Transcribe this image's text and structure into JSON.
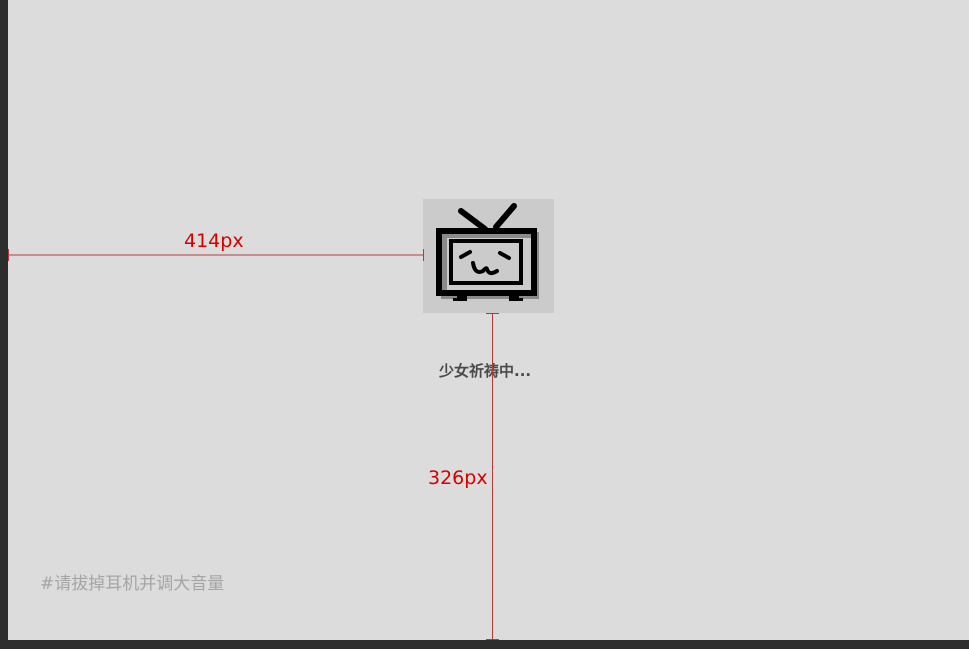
{
  "loading": {
    "text": "少女祈祷中..."
  },
  "hint": {
    "text": "#请拔掉耳机并调大音量"
  },
  "measurements": {
    "horizontal_label": "414px",
    "vertical_label": "326px"
  },
  "logo": {
    "icon": "bilibili-tv-icon"
  },
  "colors": {
    "background": "#dcdcdc",
    "logo_box": "#cbcbcb",
    "measure": "#d40000",
    "loading_text": "#4a4a4a",
    "hint_text": "#a5a5a5"
  }
}
